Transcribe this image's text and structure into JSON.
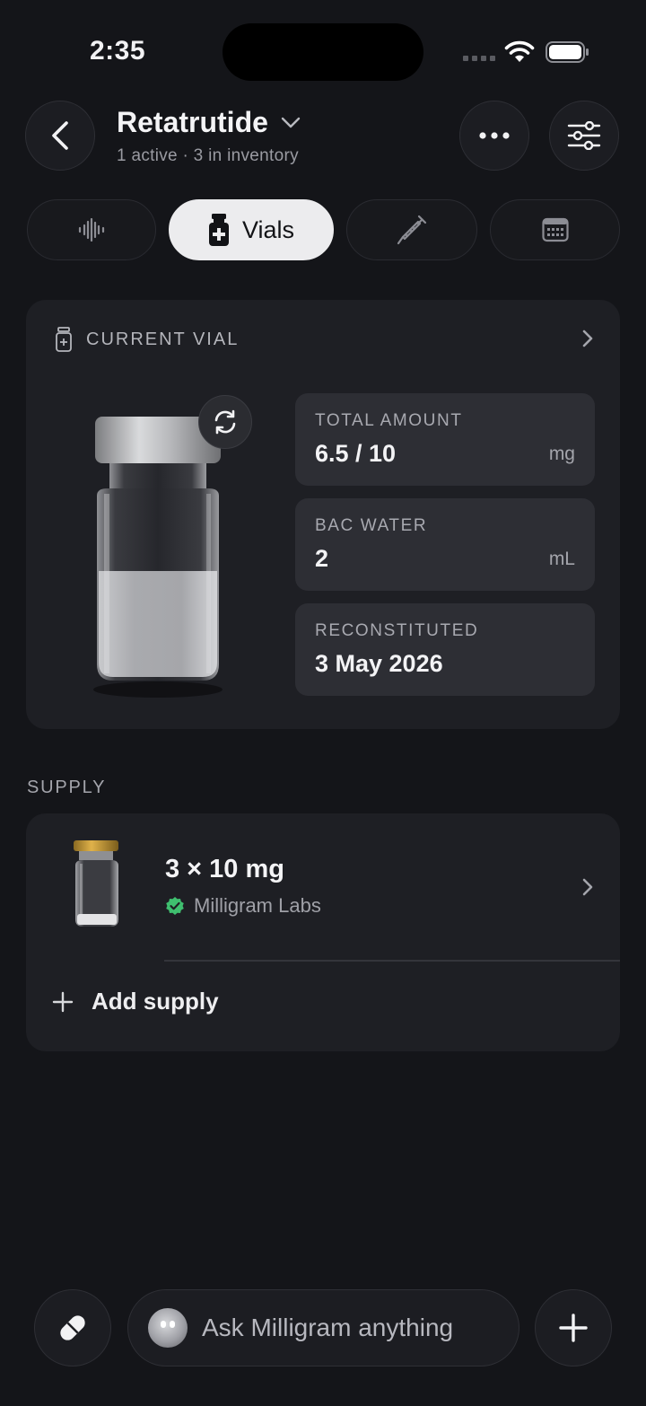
{
  "status_bar": {
    "time": "2:35"
  },
  "header": {
    "title": "Retatrutide",
    "subtitle": "1 active · 3 in inventory"
  },
  "tabs": [
    {
      "id": "activity",
      "icon": "waveform-icon",
      "label": ""
    },
    {
      "id": "vials",
      "icon": "vial-icon",
      "label": "Vials",
      "selected": true
    },
    {
      "id": "injections",
      "icon": "syringe-icon",
      "label": ""
    },
    {
      "id": "calendar",
      "icon": "calendar-icon",
      "label": ""
    }
  ],
  "current_vial": {
    "section_label": "CURRENT VIAL",
    "stats": [
      {
        "label": "TOTAL AMOUNT",
        "value": "6.5 / 10",
        "unit": "mg"
      },
      {
        "label": "BAC WATER",
        "value": "2",
        "unit": "mL"
      },
      {
        "label": "RECONSTITUTED",
        "value": "3 May 2026",
        "unit": ""
      }
    ]
  },
  "supply": {
    "section_label": "SUPPLY",
    "items": [
      {
        "quantity": "3 × 10 mg",
        "source": "Milligram Labs",
        "verified": true
      }
    ],
    "add_label": "Add supply"
  },
  "bottom_bar": {
    "ask_placeholder": "Ask Milligram anything"
  },
  "colors": {
    "background": "#141519",
    "card": "#1e1f24",
    "stat_tile": "#2d2e34",
    "selected_tab": "#ececee",
    "verified_green": "#3fbf6f"
  }
}
